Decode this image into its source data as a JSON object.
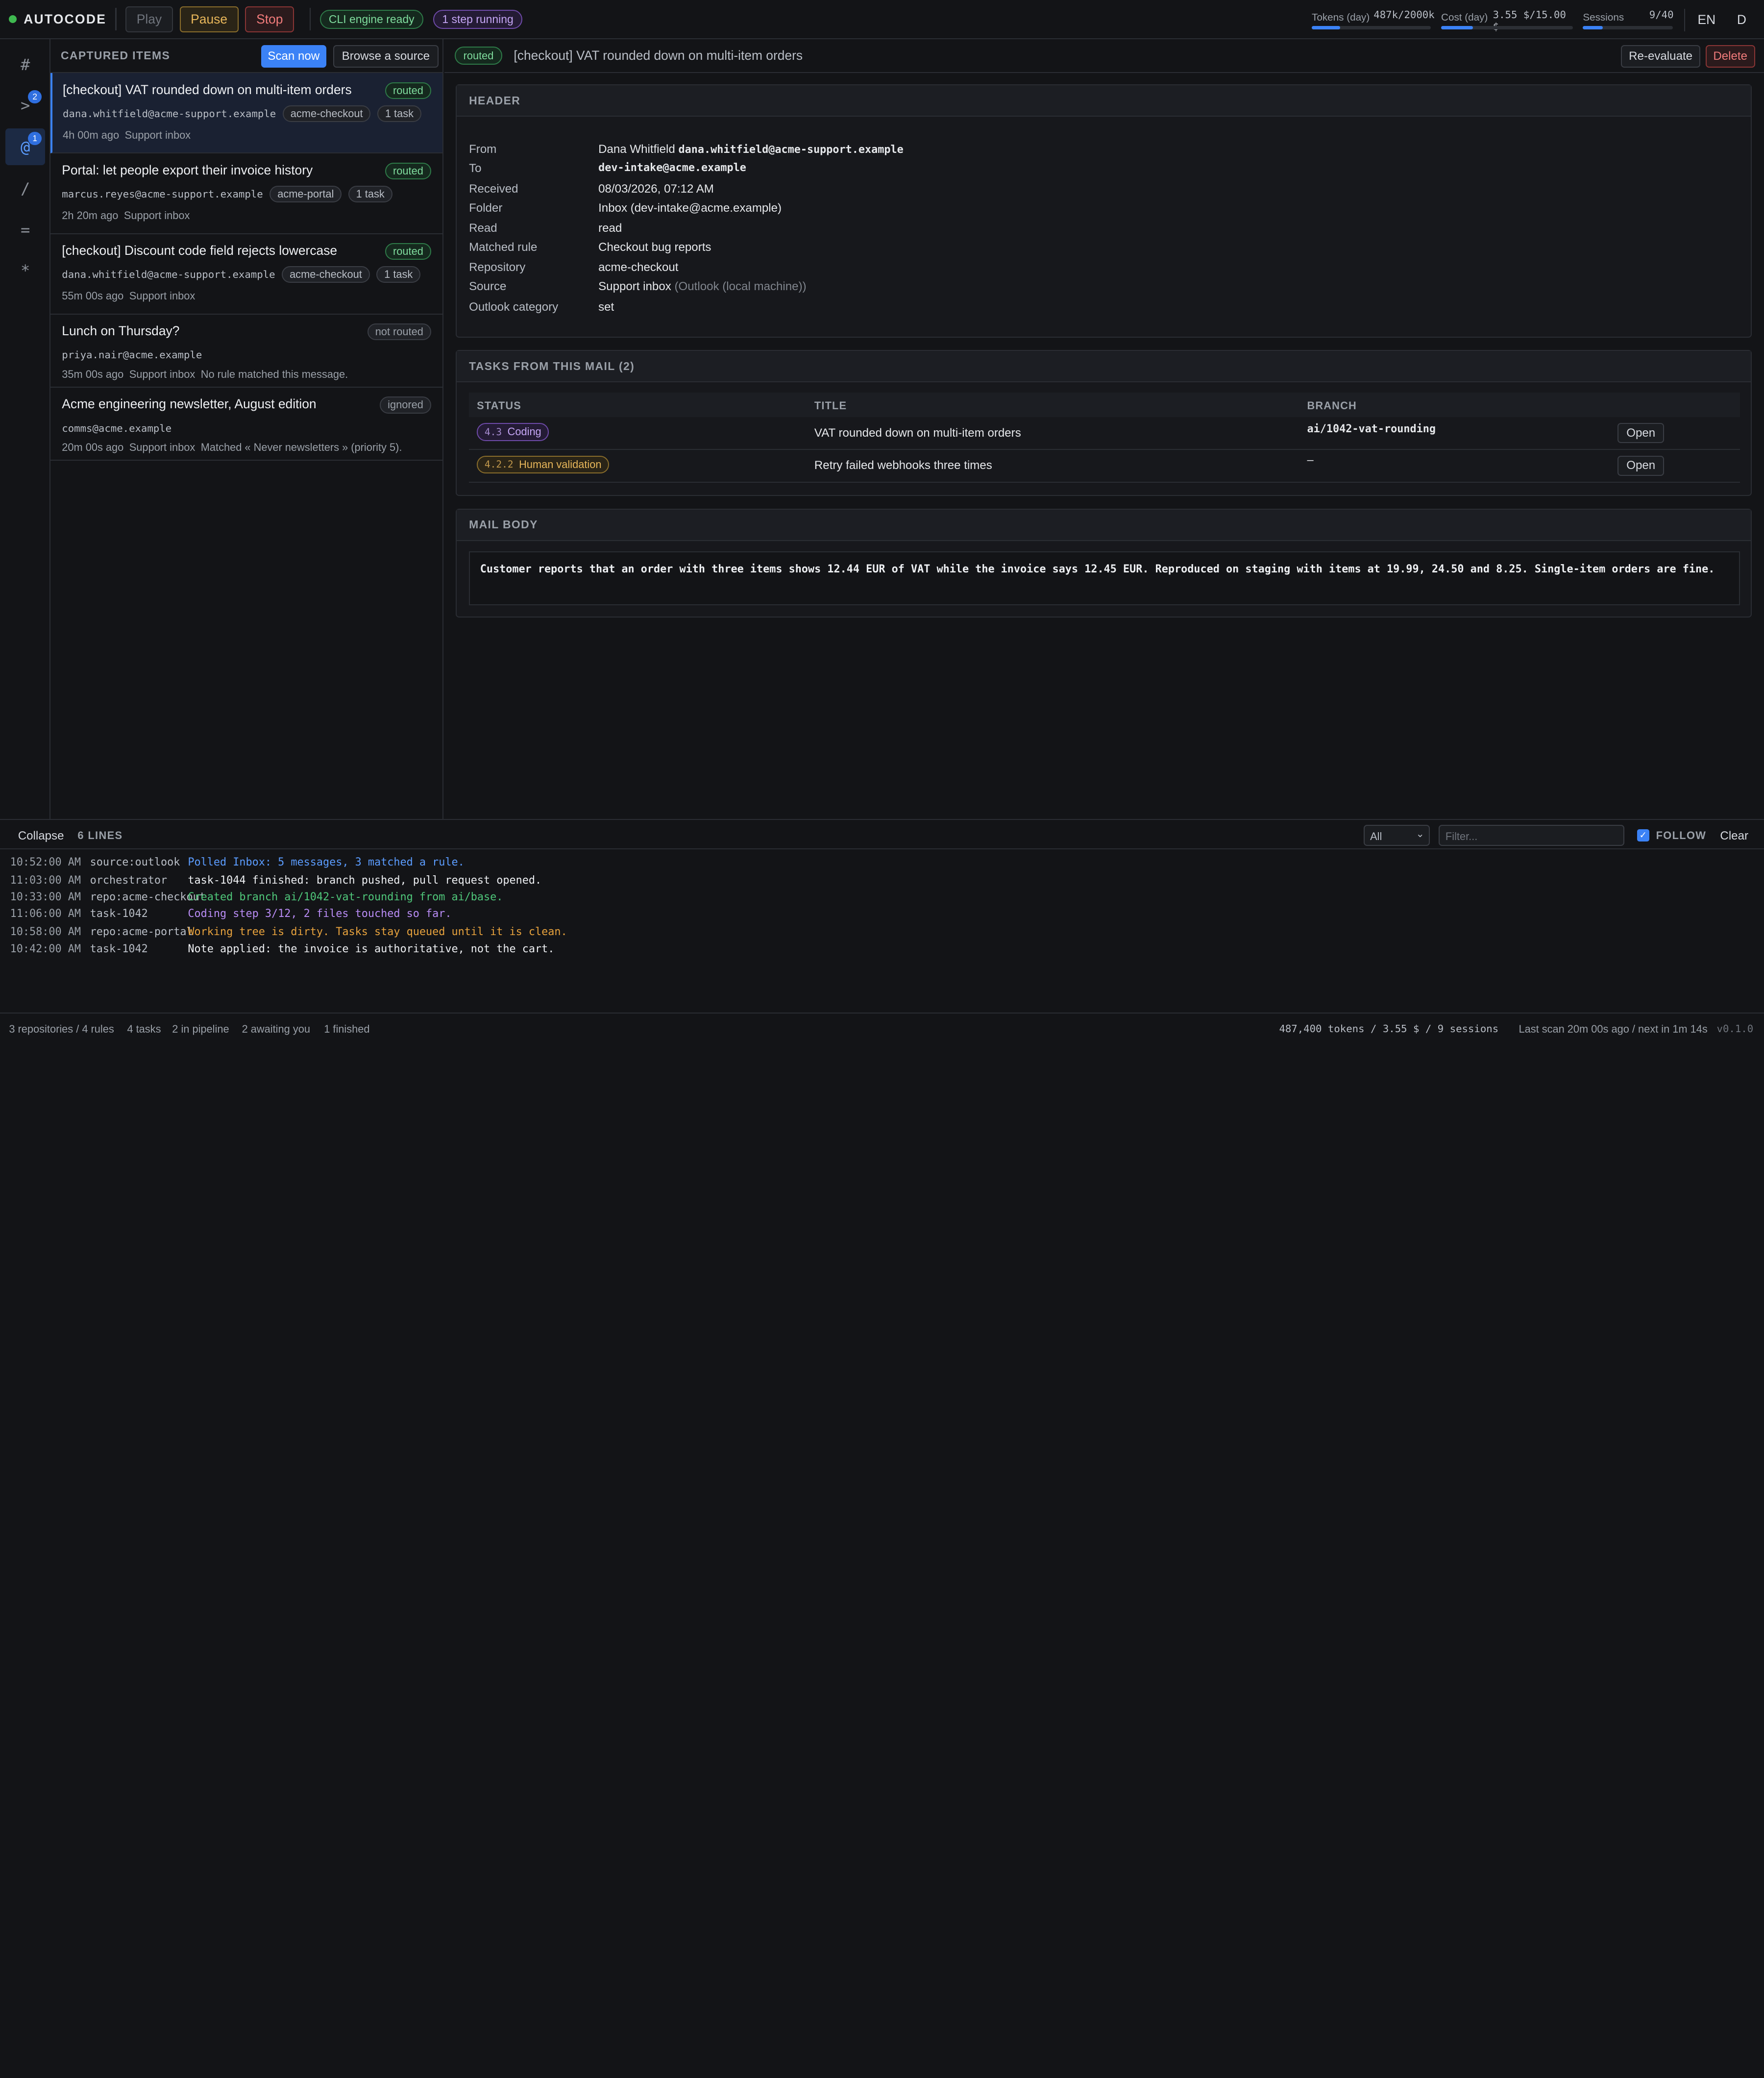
{
  "topbar": {
    "brand": "AUTOCODE",
    "play": "Play",
    "pause": "Pause",
    "stop": "Stop",
    "engine_status": "CLI engine ready",
    "running_status": "1 step running",
    "tokens_label": "Tokens (day)",
    "tokens_value": "487k/2000k",
    "tokens_fraction": 0.24,
    "cost_label": "Cost (day)",
    "cost_value": "3.55 $/15.00 $",
    "cost_fraction": 0.24,
    "sessions_label": "Sessions",
    "sessions_value": "9/40",
    "sessions_fraction": 0.22,
    "lang": "EN",
    "theme": "D"
  },
  "rail": {
    "items": [
      {
        "glyph": "#",
        "icon": "hash-icon"
      },
      {
        "glyph": ">",
        "icon": "terminal-icon",
        "badge": "2"
      },
      {
        "glyph": "@",
        "icon": "at-icon",
        "badge": "1",
        "active": true
      },
      {
        "glyph": "/",
        "icon": "slash-icon"
      },
      {
        "glyph": "=",
        "icon": "equals-icon"
      },
      {
        "glyph": "*",
        "icon": "asterisk-icon"
      }
    ]
  },
  "list": {
    "title": "CAPTURED ITEMS",
    "scan_now": "Scan now",
    "browse": "Browse a source",
    "items": [
      {
        "title": "[checkout] VAT rounded down on multi-item orders",
        "status": "routed",
        "from": "dana.whitfield@acme-support.example",
        "repo": "acme-checkout",
        "tasks": "1 task",
        "age": "4h 00m ago",
        "source": "Support inbox",
        "note": ""
      },
      {
        "title": "Portal: let people export their invoice history",
        "status": "routed",
        "from": "marcus.reyes@acme-support.example",
        "repo": "acme-portal",
        "tasks": "1 task",
        "age": "2h 20m ago",
        "source": "Support inbox",
        "note": ""
      },
      {
        "title": "[checkout] Discount code field rejects lowercase",
        "status": "routed",
        "from": "dana.whitfield@acme-support.example",
        "repo": "acme-checkout",
        "tasks": "1 task",
        "age": "55m 00s ago",
        "source": "Support inbox",
        "note": ""
      },
      {
        "title": "Lunch on Thursday?",
        "status": "not routed",
        "from": "priya.nair@acme.example",
        "repo": "",
        "tasks": "",
        "age": "35m 00s ago",
        "source": "Support inbox",
        "note": "No rule matched this message."
      },
      {
        "title": "Acme engineering newsletter, August edition",
        "status": "ignored",
        "from": "comms@acme.example",
        "repo": "",
        "tasks": "",
        "age": "20m 00s ago",
        "source": "Support inbox",
        "note": "Matched « Never newsletters » (priority 5)."
      }
    ]
  },
  "detail": {
    "status": "routed",
    "title": "[checkout] VAT rounded down on multi-item orders",
    "reevaluate": "Re-evaluate",
    "delete": "Delete",
    "header_title": "HEADER",
    "fields": {
      "from_label": "From",
      "from_name": "Dana Whitfield",
      "from_email": "dana.whitfield@acme-support.example",
      "to_label": "To",
      "to_value": "dev-intake@acme.example",
      "received_label": "Received",
      "received_value": "08/03/2026, 07:12 AM",
      "folder_label": "Folder",
      "folder_value": "Inbox (dev-intake@acme.example)",
      "read_label": "Read",
      "read_value": "read",
      "rule_label": "Matched rule",
      "rule_value": "Checkout bug reports",
      "repo_label": "Repository",
      "repo_value": "acme-checkout",
      "source_label": "Source",
      "source_value": "Support inbox",
      "source_note": "(Outlook (local machine))",
      "category_label": "Outlook category",
      "category_value": "set"
    },
    "tasks_title": "TASKS FROM THIS MAIL (2)",
    "tasks_columns": {
      "status": "STATUS",
      "title": "TITLE",
      "branch": "BRANCH"
    },
    "tasks": [
      {
        "step": "4.3",
        "status": "Coding",
        "kind": "coding",
        "title": "VAT rounded down on multi-item orders",
        "branch": "ai/1042-vat-rounding",
        "open": "Open"
      },
      {
        "step": "4.2.2",
        "status": "Human validation",
        "kind": "hv",
        "title": "Retry failed webhooks three times",
        "branch": "–",
        "open": "Open"
      }
    ],
    "body_title": "MAIL BODY",
    "body": "Customer reports that an order with three items shows 12.44 EUR of VAT while the invoice says 12.45 EUR. Reproduced on staging with items at 19.99, 24.50 and 8.25. Single-item orders are fine."
  },
  "log": {
    "collapse": "Collapse",
    "lines_label": "6 LINES",
    "filter_select": "All",
    "filter_placeholder": "Filter...",
    "follow": "FOLLOW",
    "clear": "Clear",
    "lines": [
      {
        "time": "10:52:00 AM",
        "source": "source:outlook",
        "message": "Polled Inbox: 5 messages, 3 matched a rule.",
        "color": "blue"
      },
      {
        "time": "11:03:00 AM",
        "source": "orchestrator",
        "message": "task-1044 finished: branch pushed, pull request opened.",
        "color": "white"
      },
      {
        "time": "10:33:00 AM",
        "source": "repo:acme-checkout",
        "message": "Created branch ai/1042-vat-rounding from ai/base.",
        "color": "green"
      },
      {
        "time": "11:06:00 AM",
        "source": "task-1042",
        "message": "Coding step 3/12, 2 files touched so far.",
        "color": "purple"
      },
      {
        "time": "10:58:00 AM",
        "source": "repo:acme-portal",
        "message": "Working tree is dirty. Tasks stay queued until it is clean.",
        "color": "orange"
      },
      {
        "time": "10:42:00 AM",
        "source": "task-1042",
        "message": "Note applied: the invoice is authoritative, not the cart.",
        "color": "white"
      }
    ]
  },
  "status": {
    "repos": "3 repositories / 4 rules",
    "tasks": "4 tasks",
    "pipeline": "2 in pipeline",
    "awaiting": "2 awaiting you",
    "finished": "1 finished",
    "totals": "487,400 tokens / 3.55 $ / 9 sessions",
    "scan": "Last scan 20m 00s ago / next in 1m 14s",
    "version": "v0.1.0"
  }
}
